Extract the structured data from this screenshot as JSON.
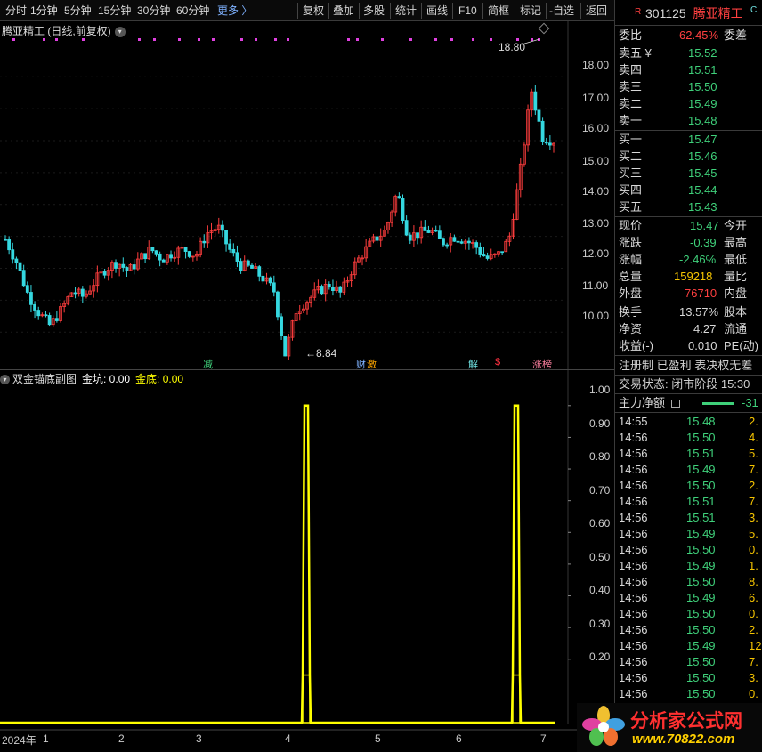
{
  "toolbar": {
    "items": [
      "分时",
      "1分钟",
      "5分钟",
      "15分钟",
      "30分钟",
      "60分钟",
      "更多 〉"
    ],
    "right_items": [
      "复权",
      "叠加",
      "多股",
      "统计",
      "画线",
      "F10",
      "简框",
      "标记",
      "-自选",
      "返回"
    ]
  },
  "main_chart": {
    "title": "腾亚精工 (日线,前复权)",
    "high_label": "18.80",
    "low_label": "←8.84",
    "y_ticks": [
      "18.00",
      "17.00",
      "16.00",
      "15.00",
      "14.00",
      "13.00",
      "12.00",
      "11.00",
      "10.00"
    ],
    "event_markers": [
      "减",
      "财",
      "激",
      "解",
      "$",
      "涨榜"
    ]
  },
  "sub_chart": {
    "title": "双金锚底副图",
    "v1_label": "金坑: 0.00",
    "v2_label": "金底: 0.00",
    "y_ticks": [
      "1.00",
      "0.90",
      "0.80",
      "0.70",
      "0.60",
      "0.50",
      "0.40",
      "0.30",
      "0.20"
    ]
  },
  "x_axis": [
    "2024年",
    "1",
    "2",
    "3",
    "4",
    "5",
    "6",
    "7"
  ],
  "chart_data": [
    {
      "type": "candlestick",
      "title": "腾亚精工 (日线,前复权)",
      "x": [
        "2024-01",
        "2024-02",
        "2024-03",
        "2024-04",
        "2024-05",
        "2024-06",
        "2024-07"
      ],
      "ylim": [
        9.7,
        18.9
      ],
      "high": 18.8,
      "low": 8.84,
      "close_path": [
        12.9,
        12.2,
        11.2,
        10.6,
        10.2,
        10.7,
        11.3,
        11.1,
        11.6,
        12.0,
        12.2,
        11.9,
        12.3,
        12.6,
        12.3,
        12.5,
        12.6,
        12.4,
        13.1,
        13.3,
        12.6,
        12.1,
        12.0,
        11.7,
        11.3,
        9.3,
        10.7,
        11.0,
        11.3,
        11.5,
        11.2,
        12.0,
        12.5,
        12.9,
        13.2,
        14.4,
        13.0,
        13.1,
        13.2,
        12.8,
        13.0,
        12.9,
        12.7,
        12.3,
        12.4,
        12.9,
        15.0,
        17.6,
        16.1,
        16.0
      ],
      "y_ticks": [
        18,
        17,
        16,
        15,
        14,
        13,
        12,
        11,
        10
      ]
    },
    {
      "type": "line",
      "title": "双金锚底副图",
      "series": [
        {
          "name": "金坑",
          "color": "#ffff00",
          "values": [
            0,
            0,
            0,
            0,
            0,
            0,
            0,
            0,
            1,
            0,
            0,
            0,
            0,
            0,
            0,
            0,
            0,
            0,
            0,
            0,
            0,
            1,
            0,
            0,
            0
          ]
        }
      ],
      "ylim": [
        0,
        1.05
      ],
      "y_ticks": [
        1.0,
        0.9,
        0.8,
        0.7,
        0.6,
        0.5,
        0.4,
        0.3,
        0.2
      ]
    }
  ],
  "panel": {
    "code": "301125",
    "name": "腾亚精工",
    "r_tag": "R",
    "c_tag": "C",
    "weibi_label": "委比",
    "weibi_value": "62.45%",
    "weicha_label": "委差",
    "asks": [
      {
        "label": "卖五 ¥",
        "price": "15.52"
      },
      {
        "label": "卖四",
        "price": "15.51"
      },
      {
        "label": "卖三",
        "price": "15.50"
      },
      {
        "label": "卖二",
        "price": "15.49"
      },
      {
        "label": "卖一",
        "price": "15.48"
      }
    ],
    "bids": [
      {
        "label": "买一",
        "price": "15.47"
      },
      {
        "label": "买二",
        "price": "15.46"
      },
      {
        "label": "买三",
        "price": "15.45"
      },
      {
        "label": "买四",
        "price": "15.44"
      },
      {
        "label": "买五",
        "price": "15.43"
      }
    ],
    "stats": [
      {
        "label": "现价",
        "value": "15.47",
        "label2": "今开"
      },
      {
        "label": "涨跌",
        "value": "-0.39",
        "label2": "最高"
      },
      {
        "label": "涨幅",
        "value": "-2.46%",
        "label2": "最低"
      },
      {
        "label": "总量",
        "value": "159218",
        "label2": "量比"
      },
      {
        "label": "外盘",
        "value": "76710",
        "label2": "内盘"
      }
    ],
    "stats2": [
      {
        "label": "换手",
        "value": "13.57%",
        "label2": "股本"
      },
      {
        "label": "净资",
        "value": "4.27",
        "label2": "流通"
      },
      {
        "label": "收益(-)",
        "value": "0.010",
        "label2": "PE(动)"
      }
    ],
    "reg_line": "注册制  已盈利  表决权无差",
    "trade_status": "交易状态: 闭市阶段 15:30",
    "net_flow_label": "主力净额",
    "net_flow_value": "-31",
    "ticks": [
      {
        "time": "14:55",
        "price": "15.48",
        "vol": "2."
      },
      {
        "time": "14:56",
        "price": "15.50",
        "vol": "4."
      },
      {
        "time": "14:56",
        "price": "15.51",
        "vol": "5."
      },
      {
        "time": "14:56",
        "price": "15.49",
        "vol": "7."
      },
      {
        "time": "14:56",
        "price": "15.50",
        "vol": "2."
      },
      {
        "time": "14:56",
        "price": "15.51",
        "vol": "7."
      },
      {
        "time": "14:56",
        "price": "15.51",
        "vol": "3."
      },
      {
        "time": "14:56",
        "price": "15.49",
        "vol": "5."
      },
      {
        "time": "14:56",
        "price": "15.50",
        "vol": "0."
      },
      {
        "time": "14:56",
        "price": "15.49",
        "vol": "1."
      },
      {
        "time": "14:56",
        "price": "15.50",
        "vol": "8."
      },
      {
        "time": "14:56",
        "price": "15.49",
        "vol": "6."
      },
      {
        "time": "14:56",
        "price": "15.50",
        "vol": "0."
      },
      {
        "time": "14:56",
        "price": "15.50",
        "vol": "2."
      },
      {
        "time": "14:56",
        "price": "15.49",
        "vol": "12."
      },
      {
        "time": "14:56",
        "price": "15.50",
        "vol": "7."
      },
      {
        "time": "14:56",
        "price": "15.50",
        "vol": "3."
      },
      {
        "time": "14:56",
        "price": "15.50",
        "vol": "0."
      }
    ]
  },
  "logo": {
    "text": "分析家公式网",
    "url_text": "www.70822.com"
  }
}
